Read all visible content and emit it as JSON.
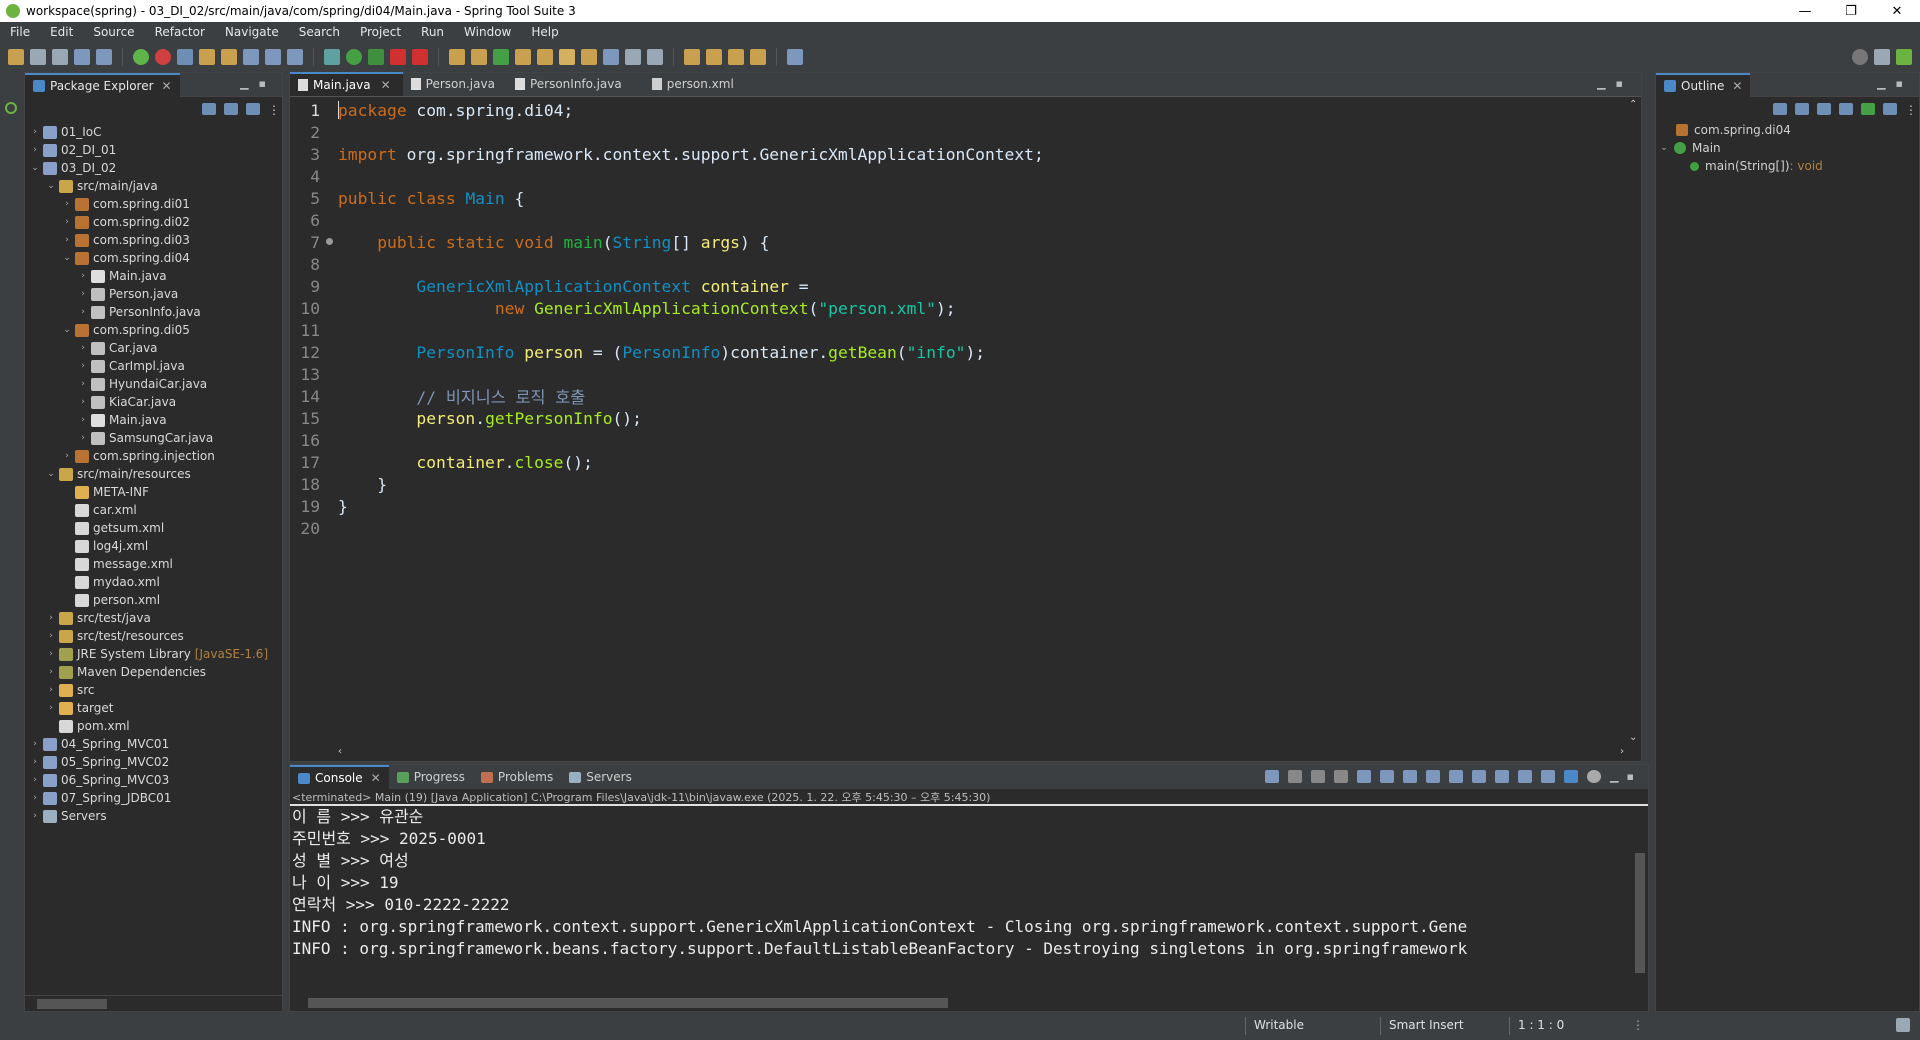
{
  "window": {
    "title": "workspace(spring) - 03_DI_02/src/main/java/com/spring/di04/Main.java - Spring Tool Suite 3",
    "min": "—",
    "max": "❐",
    "close": "✕"
  },
  "menu": [
    "File",
    "Edit",
    "Source",
    "Refactor",
    "Navigate",
    "Search",
    "Project",
    "Run",
    "Window",
    "Help"
  ],
  "package_explorer": {
    "title": "Package Explorer",
    "tree": [
      {
        "label": "01_IoC",
        "indent": 0,
        "toggle": "›",
        "kind": "proj"
      },
      {
        "label": "02_DI_01",
        "indent": 0,
        "toggle": "›",
        "kind": "proj"
      },
      {
        "label": "03_DI_02",
        "indent": 0,
        "toggle": "⌄",
        "kind": "proj"
      },
      {
        "label": "src/main/java",
        "indent": 1,
        "toggle": "⌄",
        "kind": "src"
      },
      {
        "label": "com.spring.di01",
        "indent": 2,
        "toggle": "›",
        "kind": "pkg"
      },
      {
        "label": "com.spring.di02",
        "indent": 2,
        "toggle": "›",
        "kind": "pkg"
      },
      {
        "label": "com.spring.di03",
        "indent": 2,
        "toggle": "›",
        "kind": "pkg"
      },
      {
        "label": "com.spring.di04",
        "indent": 2,
        "toggle": "⌄",
        "kind": "pkg"
      },
      {
        "label": "Main.java",
        "indent": 3,
        "toggle": "›",
        "kind": "java"
      },
      {
        "label": "Person.java",
        "indent": 3,
        "toggle": "›",
        "kind": "jif"
      },
      {
        "label": "PersonInfo.java",
        "indent": 3,
        "toggle": "›",
        "kind": "jif"
      },
      {
        "label": "com.spring.di05",
        "indent": 2,
        "toggle": "⌄",
        "kind": "pkg"
      },
      {
        "label": "Car.java",
        "indent": 3,
        "toggle": "›",
        "kind": "jif"
      },
      {
        "label": "CarImpl.java",
        "indent": 3,
        "toggle": "›",
        "kind": "jif"
      },
      {
        "label": "HyundaiCar.java",
        "indent": 3,
        "toggle": "›",
        "kind": "jif"
      },
      {
        "label": "KiaCar.java",
        "indent": 3,
        "toggle": "›",
        "kind": "jif"
      },
      {
        "label": "Main.java",
        "indent": 3,
        "toggle": "›",
        "kind": "java"
      },
      {
        "label": "SamsungCar.java",
        "indent": 3,
        "toggle": "›",
        "kind": "jif"
      },
      {
        "label": "com.spring.injection",
        "indent": 2,
        "toggle": "›",
        "kind": "pkg"
      },
      {
        "label": "src/main/resources",
        "indent": 1,
        "toggle": "⌄",
        "kind": "src"
      },
      {
        "label": "META-INF",
        "indent": 2,
        "toggle": "",
        "kind": "folder"
      },
      {
        "label": "car.xml",
        "indent": 2,
        "toggle": "",
        "kind": "xml"
      },
      {
        "label": "getsum.xml",
        "indent": 2,
        "toggle": "",
        "kind": "xml"
      },
      {
        "label": "log4j.xml",
        "indent": 2,
        "toggle": "",
        "kind": "xml"
      },
      {
        "label": "message.xml",
        "indent": 2,
        "toggle": "",
        "kind": "xml"
      },
      {
        "label": "mydao.xml",
        "indent": 2,
        "toggle": "",
        "kind": "xml"
      },
      {
        "label": "person.xml",
        "indent": 2,
        "toggle": "",
        "kind": "xml"
      },
      {
        "label": "src/test/java",
        "indent": 1,
        "toggle": "›",
        "kind": "src"
      },
      {
        "label": "src/test/resources",
        "indent": 1,
        "toggle": "›",
        "kind": "src"
      },
      {
        "label": "JRE System Library",
        "suffix": "[JavaSE-1.6]",
        "indent": 1,
        "toggle": "›",
        "kind": "lib"
      },
      {
        "label": "Maven Dependencies",
        "indent": 1,
        "toggle": "›",
        "kind": "lib"
      },
      {
        "label": "src",
        "indent": 1,
        "toggle": "›",
        "kind": "folder"
      },
      {
        "label": "target",
        "indent": 1,
        "toggle": "›",
        "kind": "folder"
      },
      {
        "label": "pom.xml",
        "indent": 1,
        "toggle": "",
        "kind": "xml"
      },
      {
        "label": "04_Spring_MVC01",
        "indent": 0,
        "toggle": "›",
        "kind": "proj"
      },
      {
        "label": "05_Spring_MVC02",
        "indent": 0,
        "toggle": "›",
        "kind": "proj"
      },
      {
        "label": "06_Spring_MVC03",
        "indent": 0,
        "toggle": "›",
        "kind": "proj"
      },
      {
        "label": "07_Spring_JDBC01",
        "indent": 0,
        "toggle": "›",
        "kind": "proj"
      },
      {
        "label": "Servers",
        "indent": 0,
        "toggle": "›",
        "kind": "srv"
      }
    ]
  },
  "editor": {
    "tabs": [
      {
        "label": "Main.java",
        "active": true,
        "closable": true
      },
      {
        "label": "Person.java",
        "active": false
      },
      {
        "label": "PersonInfo.java",
        "active": false
      },
      {
        "label": "person.xml",
        "active": false
      }
    ],
    "lines": [
      {
        "n": "1",
        "tokens": [
          [
            "kw",
            "package"
          ],
          [
            "pl",
            " com.spring.di04;"
          ]
        ]
      },
      {
        "n": "2",
        "tokens": []
      },
      {
        "n": "3",
        "tokens": [
          [
            "kw",
            "import"
          ],
          [
            "pl",
            " org.springframework.context.support.GenericXmlApplicationContext;"
          ]
        ]
      },
      {
        "n": "4",
        "tokens": []
      },
      {
        "n": "5",
        "tokens": [
          [
            "kw",
            "public class"
          ],
          [
            "pl",
            " "
          ],
          [
            "ty",
            "Main"
          ],
          [
            "pl",
            " {"
          ]
        ]
      },
      {
        "n": "6",
        "tokens": []
      },
      {
        "n": "7",
        "marker": true,
        "tokens": [
          [
            "pl",
            "    "
          ],
          [
            "kw",
            "public static void"
          ],
          [
            "pl",
            " "
          ],
          [
            "fn",
            "main"
          ],
          [
            "pl",
            "("
          ],
          [
            "ty",
            "String"
          ],
          [
            "pl",
            "[] "
          ],
          [
            "vr",
            "args"
          ],
          [
            "pl",
            ") {"
          ]
        ]
      },
      {
        "n": "8",
        "tokens": []
      },
      {
        "n": "9",
        "tokens": [
          [
            "pl",
            "        "
          ],
          [
            "ty",
            "GenericXmlApplicationContext"
          ],
          [
            "pl",
            " "
          ],
          [
            "vr",
            "container"
          ],
          [
            "pl",
            " ="
          ]
        ]
      },
      {
        "n": "10",
        "tokens": [
          [
            "pl",
            "                "
          ],
          [
            "kw",
            "new"
          ],
          [
            "pl",
            " "
          ],
          [
            "mt",
            "GenericXmlApplicationContext"
          ],
          [
            "pl",
            "("
          ],
          [
            "st",
            "\"person.xml\""
          ],
          [
            "pl",
            ");"
          ]
        ]
      },
      {
        "n": "11",
        "tokens": []
      },
      {
        "n": "12",
        "tokens": [
          [
            "pl",
            "        "
          ],
          [
            "ty",
            "PersonInfo"
          ],
          [
            "pl",
            " "
          ],
          [
            "vr",
            "person"
          ],
          [
            "pl",
            " = ("
          ],
          [
            "ty",
            "PersonInfo"
          ],
          [
            "pl",
            ")container."
          ],
          [
            "mt",
            "getBean"
          ],
          [
            "pl",
            "("
          ],
          [
            "st",
            "\"info\""
          ],
          [
            "pl",
            ");"
          ]
        ]
      },
      {
        "n": "13",
        "tokens": []
      },
      {
        "n": "14",
        "tokens": [
          [
            "pl",
            "        "
          ],
          [
            "cm",
            "// 비지니스 로직 호출"
          ]
        ]
      },
      {
        "n": "15",
        "tokens": [
          [
            "pl",
            "        "
          ],
          [
            "vr",
            "person"
          ],
          [
            "pl",
            "."
          ],
          [
            "mt",
            "getPersonInfo"
          ],
          [
            "pl",
            "();"
          ]
        ]
      },
      {
        "n": "16",
        "tokens": []
      },
      {
        "n": "17",
        "tokens": [
          [
            "pl",
            "        "
          ],
          [
            "vr",
            "container"
          ],
          [
            "pl",
            "."
          ],
          [
            "mt",
            "close"
          ],
          [
            "pl",
            "();"
          ]
        ]
      },
      {
        "n": "18",
        "tokens": [
          [
            "pl",
            "    }"
          ]
        ]
      },
      {
        "n": "19",
        "tokens": [
          [
            "pl",
            "}"
          ]
        ]
      },
      {
        "n": "20",
        "tokens": []
      }
    ]
  },
  "console": {
    "tabs": [
      {
        "label": "Console",
        "active": true,
        "closable": true,
        "color": "#4a88c7"
      },
      {
        "label": "Progress",
        "active": false,
        "color": "#5aa05a"
      },
      {
        "label": "Problems",
        "active": false,
        "color": "#c07050"
      },
      {
        "label": "Servers",
        "active": false,
        "color": "#9ab0c0"
      }
    ],
    "status": "<terminated> Main (19) [Java Application] C:\\Program Files\\Java\\jdk-11\\bin\\javaw.exe  (2025. 1. 22. 오후 5:45:30 – 오후 5:45:30)",
    "output": [
      "이 름 >>> 유관순",
      "주민번호 >>> 2025-0001",
      "성 별 >>> 여성",
      "나 이 >>> 19",
      "연락처 >>> 010-2222-2222",
      "INFO : org.springframework.context.support.GenericXmlApplicationContext - Closing org.springframework.context.support.Gene",
      "INFO : org.springframework.beans.factory.support.DefaultListableBeanFactory - Destroying singletons in org.springframework"
    ]
  },
  "outline": {
    "title": "Outline",
    "package": "com.spring.di04",
    "class_name": "Main",
    "method": "main(String[])",
    "return_type": " : void"
  },
  "statusbar": {
    "writable": "Writable",
    "insert_mode": "Smart Insert",
    "position": "1 : 1 : 0"
  },
  "colors": {
    "keyword": "#cc6c1d",
    "type": "#1290c3",
    "string": "#17c6a3",
    "method": "#a7ec21",
    "variable": "#f3ec79",
    "comment": "#7f94b3",
    "accent": "#4a88c7"
  }
}
